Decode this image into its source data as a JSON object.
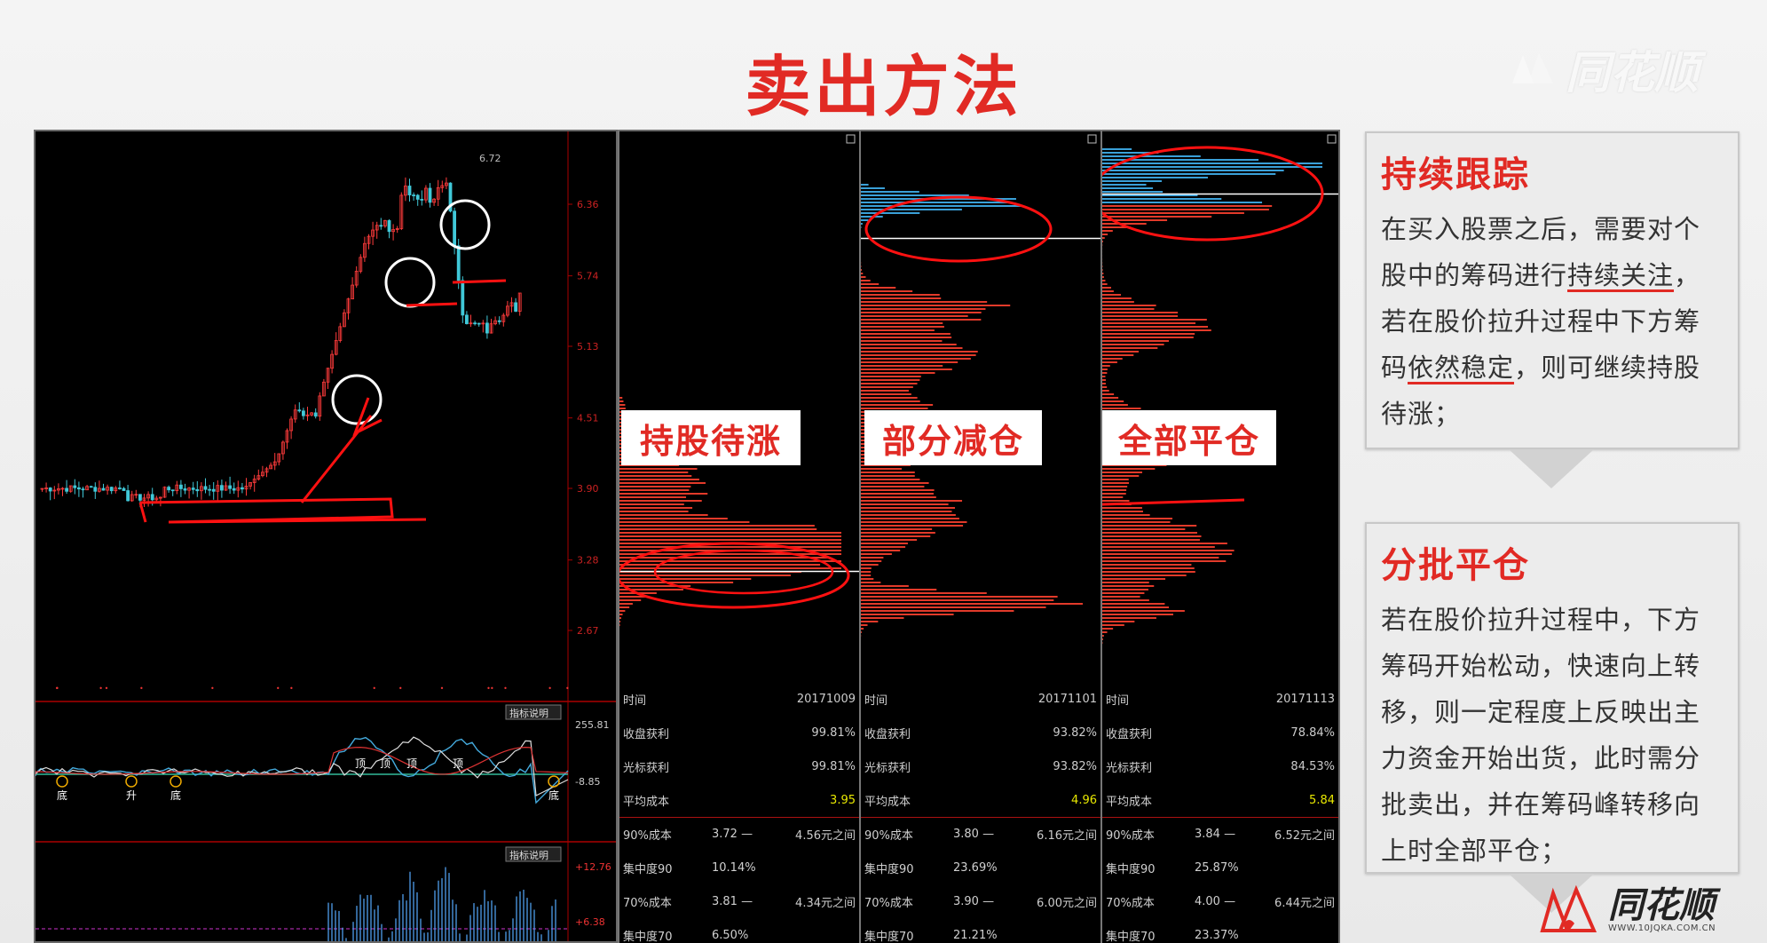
{
  "slide": {
    "title": "卖出方法",
    "logo_text": "同花顺",
    "logo_url_text": "WWW.10JQKA.COM.CN"
  },
  "kline": {
    "price_ticks": [
      "6.36",
      "5.74",
      "5.13",
      "4.51",
      "3.90",
      "3.28",
      "2.67"
    ],
    "high_label": "6.72",
    "indicator_1": {
      "button": "指标说明",
      "top_value": "255.81",
      "mid_value": "-8.85"
    },
    "indicator_2": {
      "button": "指标说明",
      "top_value": "+12.76",
      "mid_value": "+6.38"
    },
    "signal_labels": [
      "底",
      "升",
      "底",
      "顶",
      "顶",
      "顶",
      "顶",
      "底"
    ]
  },
  "chart_data": [
    {
      "type": "bar",
      "title": "持股待涨",
      "stats": {
        "time": "20171009",
        "close_profit": "99.81%",
        "cursor_profit": "99.81%",
        "avg_cost": "3.95",
        "cost90_low": "3.72",
        "cost90_high": "4.56元之间",
        "conc90": "10.14%",
        "cost70_low": "3.81",
        "cost70_high": "4.34元之间",
        "conc70": "6.50%"
      }
    },
    {
      "type": "bar",
      "title": "部分减仓",
      "stats": {
        "time": "20171101",
        "close_profit": "93.82%",
        "cursor_profit": "93.82%",
        "avg_cost": "4.96",
        "cost90_low": "3.80",
        "cost90_high": "6.16元之间",
        "conc90": "23.69%",
        "cost70_low": "3.90",
        "cost70_high": "6.00元之间",
        "conc70": "21.21%"
      }
    },
    {
      "type": "bar",
      "title": "全部平仓",
      "stats": {
        "time": "20171113",
        "close_profit": "78.84%",
        "cursor_profit": "84.53%",
        "avg_cost": "5.84",
        "cost90_low": "3.84",
        "cost90_high": "6.52元之间",
        "conc90": "25.87%",
        "cost70_low": "4.00",
        "cost70_high": "6.44元之间",
        "conc70": "23.37%"
      }
    }
  ],
  "stat_labels": {
    "time": "时间",
    "close_profit": "收盘获利",
    "cursor_profit": "光标获利",
    "avg_cost": "平均成本",
    "cost90": "90%成本",
    "conc90": "集中度90",
    "cost70": "70%成本",
    "conc70": "集中度70",
    "dash": "—"
  },
  "boxes": [
    {
      "heading": "持续跟踪",
      "body_1": "在买入股票之后，需要对个股中的筹码进行",
      "body_ul_1": "持续关注",
      "body_2": "，若在股价拉升过程中下方筹码",
      "body_ul_2": "依然稳定",
      "body_3": "，则可继续持股待涨；"
    },
    {
      "heading": "分批平仓",
      "body": "若在股价拉升过程中，下方筹码开始松动，快速向上转移，则一定程度上反映出主力资金开始出货，此时需分批卖出，并在筹码峰转移向上时全部平仓；"
    }
  ],
  "colors": {
    "accent": "#e12a24",
    "up": "#ff3b3b",
    "down": "#40c8d8",
    "chip_red": "#e23a2a",
    "chip_blue": "#3aa0d8"
  }
}
